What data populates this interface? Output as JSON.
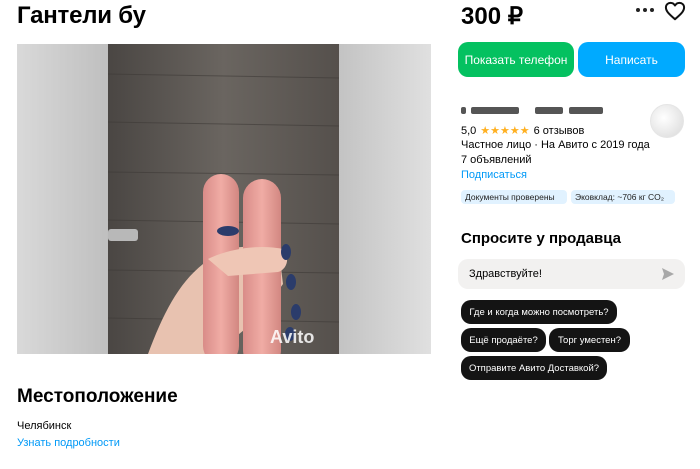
{
  "listing": {
    "title": "Гантели бу",
    "price": "300 ₽"
  },
  "actions": {
    "show_phone": "Показать телефон",
    "write": "Написать"
  },
  "gallery": {
    "watermark": "Avito"
  },
  "seller": {
    "rating": "5,0",
    "stars": "★★★★★",
    "reviews": "6 отзывов",
    "type": "Частное лицо · На Авито с 2019 года",
    "ads": "7 объявлений",
    "subscribe": "Подписаться",
    "badges": [
      "Документы проверены",
      "Эковклад: ~706 кг CO₂"
    ]
  },
  "ask": {
    "title": "Спросите у продавца",
    "input_value": "Здравствуйте!",
    "quick_questions": [
      "Где и когда можно посмотреть?",
      "Ещё продаёте?",
      "Торг уместен?",
      "Отправите Авито Доставкой?"
    ]
  },
  "location": {
    "title": "Местоположение",
    "city": "Челябинск",
    "details_link": "Узнать подробности"
  },
  "colors": {
    "green_button": "#04c160",
    "blue_button": "#00aaff",
    "link": "#0099f7",
    "star": "#ffb021",
    "chip": "#141414",
    "badge": "#e1f2ff"
  },
  "icons": [
    "more-icon",
    "heart-icon",
    "send-icon",
    "star-icon"
  ]
}
